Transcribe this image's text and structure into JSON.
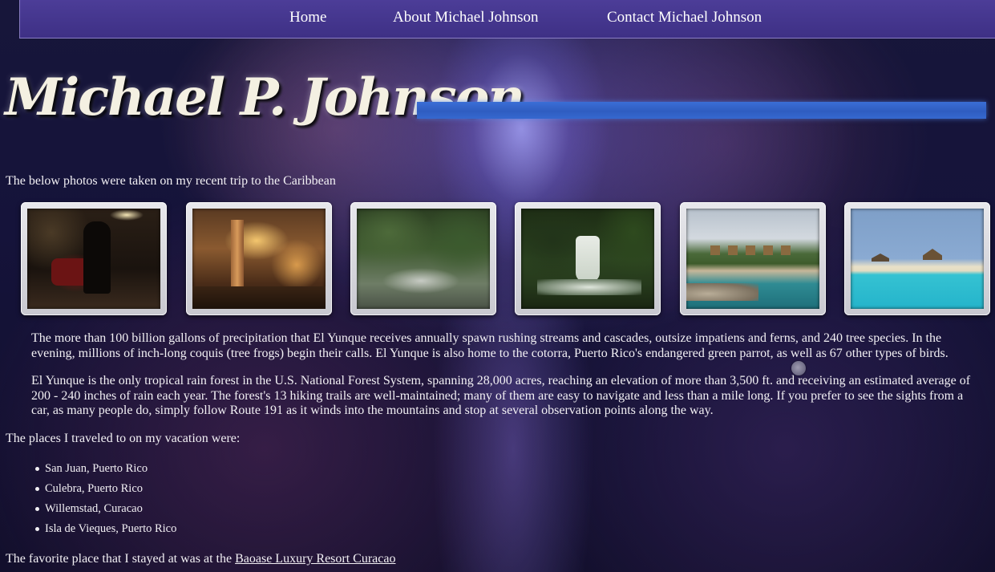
{
  "nav": {
    "home": "Home",
    "about": "About Michael Johnson",
    "contact": "Contact Michael Johnson"
  },
  "header": {
    "logo_text": "Michael P. Johnson",
    "accent_bar_color": "#3568cf"
  },
  "intro": "The below photos were taken on my recent trip to the Caribbean",
  "photos": [
    {
      "subject": "horse statue in hotel lobby"
    },
    {
      "subject": "hotel lobby interior"
    },
    {
      "subject": "rainforest stream"
    },
    {
      "subject": "waterfall"
    },
    {
      "subject": "resort beach with huts"
    },
    {
      "subject": "turquoise sea and beach huts"
    }
  ],
  "paragraphs": [
    "The more than 100 billion gallons of precipitation that El Yunque receives annually spawn rushing streams and cascades, outsize impatiens and ferns, and 240 tree species. In the evening, millions of inch-long coquis (tree frogs) begin their calls. El Yunque is also home to the cotorra, Puerto Rico's endangered green parrot, as well as 67 other types of birds.",
    "El Yunque is the only tropical rain forest in the U.S. National Forest System, spanning 28,000 acres, reaching an elevation of more than 3,500 ft. and receiving an estimated average of 200 - 240 inches of rain each year. The forest's 13 hiking trails are well-maintained; many of them are easy to navigate and less than a mile long. If you prefer to see the sights from a car, as many people do, simply follow Route 191 as it winds into the mountains and stop at several observation points along the way."
  ],
  "places": {
    "heading": "The places I traveled to on my vacation were:",
    "items": [
      "San Juan, Puerto Rico",
      "Culebra, Puerto Rico",
      "Willemstad, Curacao",
      "Isla de Vieques, Puerto Rico"
    ]
  },
  "favorite": {
    "prefix": "The favorite place that I stayed at was at the ",
    "link_text": "Baoase Luxury Resort Curacao"
  },
  "colors": {
    "nav_background": "#4c3d98",
    "text": "#f2f0f4"
  }
}
